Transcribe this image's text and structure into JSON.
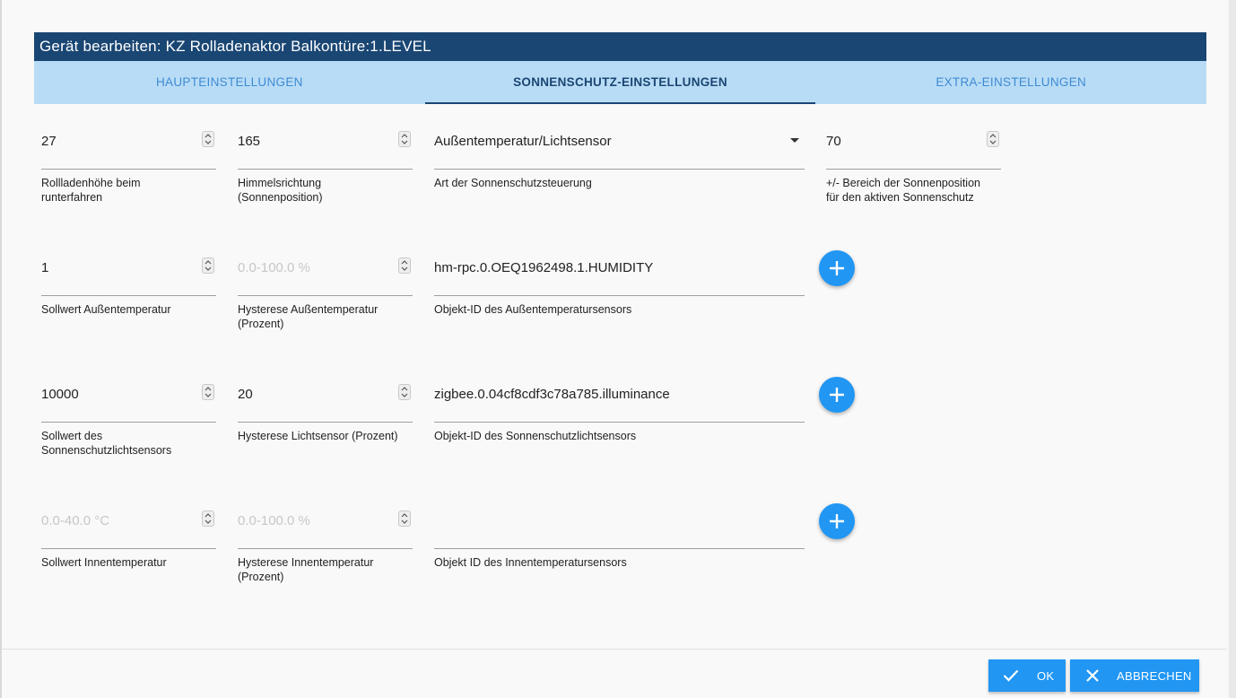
{
  "dialog": {
    "title": "Gerät bearbeiten: KZ Rolladenaktor Balkontüre:1.LEVEL"
  },
  "tabs": [
    {
      "label": "HAUPTEINSTELLUNGEN",
      "active": false
    },
    {
      "label": "SONNENSCHUTZ-EINSTELLUNGEN",
      "active": true
    },
    {
      "label": "EXTRA-EINSTELLUNGEN",
      "active": false
    }
  ],
  "row1": {
    "height": {
      "value": "27",
      "label_line1": "Rollladenhöhe beim",
      "label_line2": "runterfahren"
    },
    "direction": {
      "value": "165",
      "label_line1": "Himmelsrichtung",
      "label_line2": "(Sonnenposition)"
    },
    "type": {
      "value": "Außentemperatur/Lichtsensor",
      "label_line1": "Art der Sonnenschutzsteuerung"
    },
    "range": {
      "value": "70",
      "label_line1": "+/- Bereich der Sonnenposition",
      "label_line2": "für den aktiven Sonnenschutz"
    }
  },
  "row2": {
    "setpoint": {
      "value": "1",
      "label_line1": "Sollwert Außentemperatur"
    },
    "hysteresis": {
      "placeholder": "0.0-100.0 %",
      "label_line1": "Hysterese Außentemperatur",
      "label_line2": "(Prozent)"
    },
    "object_id": {
      "value": "hm-rpc.0.OEQ1962498.1.HUMIDITY",
      "label_line1": "Objekt-ID des Außentemperatursensors"
    }
  },
  "row3": {
    "setpoint": {
      "value": "10000",
      "label_line1": "Sollwert des",
      "label_line2": "Sonnenschutzlichtsensors"
    },
    "hysteresis": {
      "value": "20",
      "label_line1": "Hysterese Lichtsensor (Prozent)"
    },
    "object_id": {
      "value": "zigbee.0.04cf8cdf3c78a785.illuminance",
      "label_line1": "Objekt-ID des Sonnenschutzlichtsensors"
    }
  },
  "row4": {
    "setpoint": {
      "placeholder": "0.0-40.0 °C",
      "label_line1": "Sollwert Innentemperatur"
    },
    "hysteresis": {
      "placeholder": "0.0-100.0 %",
      "label_line1": "Hysterese Innentemperatur",
      "label_line2": "(Prozent)"
    },
    "object_id": {
      "value": "",
      "label_line1": "Objekt ID des Innentemperatursensors"
    }
  },
  "buttons": {
    "ok": "OK",
    "cancel": "ABBRECHEN"
  },
  "colors": {
    "title_bar": "#1a4673",
    "tab_bar": "#b9dcf6",
    "accent": "#2196f3"
  },
  "icons": {
    "add": "plus-icon",
    "ok": "check-icon",
    "cancel": "close-icon",
    "spinner": "spinner-arrows-icon",
    "dropdown": "dropdown-arrow-icon"
  }
}
